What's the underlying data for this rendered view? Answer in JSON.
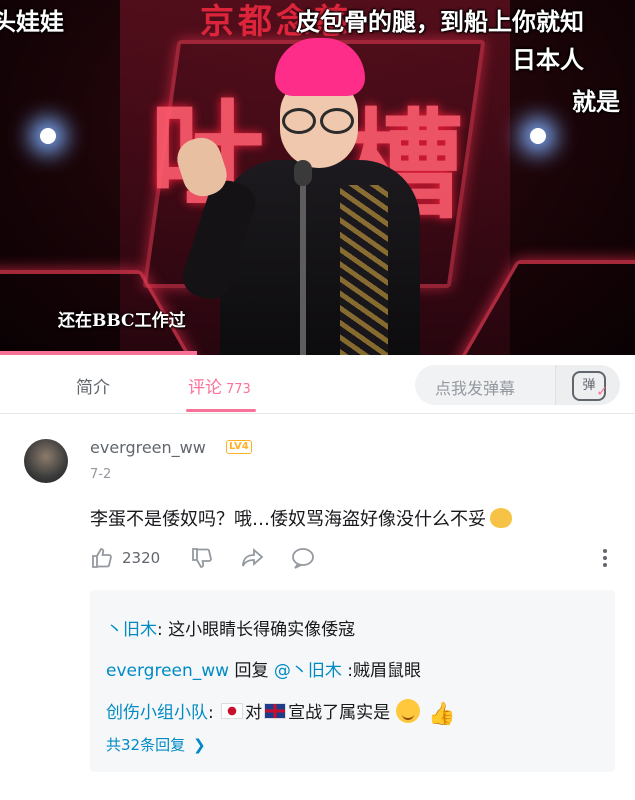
{
  "video": {
    "danmaku": [
      "头娃娃",
      "皮包骨的腿，到船上你就知",
      "日本人",
      "就是"
    ],
    "caption": "还在BBC工作过",
    "show_title": "京都念慈",
    "stage_chars": [
      "吐",
      "槽"
    ],
    "progress": 0.31
  },
  "tabs": {
    "intro": "简介",
    "comments": "评论",
    "comments_count": "773",
    "danmaku_placeholder": "点我发弹幕",
    "danmaku_icon": "弹"
  },
  "comment": {
    "username": "evergreen_ww",
    "level": "LV4",
    "date": "7-2",
    "text": "李蛋不是倭奴吗？哦…倭奴骂海盗好像没什么不妥",
    "likes": "2320"
  },
  "replies": [
    {
      "name": "丶旧木",
      "text": ": 这小眼睛长得确实像倭寇"
    },
    {
      "name": "evergreen_ww",
      "text_pre": " 回复 ",
      "mention": "@丶旧木",
      "text": " :贼眉鼠眼"
    },
    {
      "name": "创伤小组小队",
      "text_pre": ": ",
      "text_mid": "对",
      "text": "宣战了属实是"
    }
  ],
  "more_replies": "共32条回复",
  "colors": {
    "accent": "#fb7299",
    "link": "#008ac5",
    "level": "#ffb027"
  }
}
